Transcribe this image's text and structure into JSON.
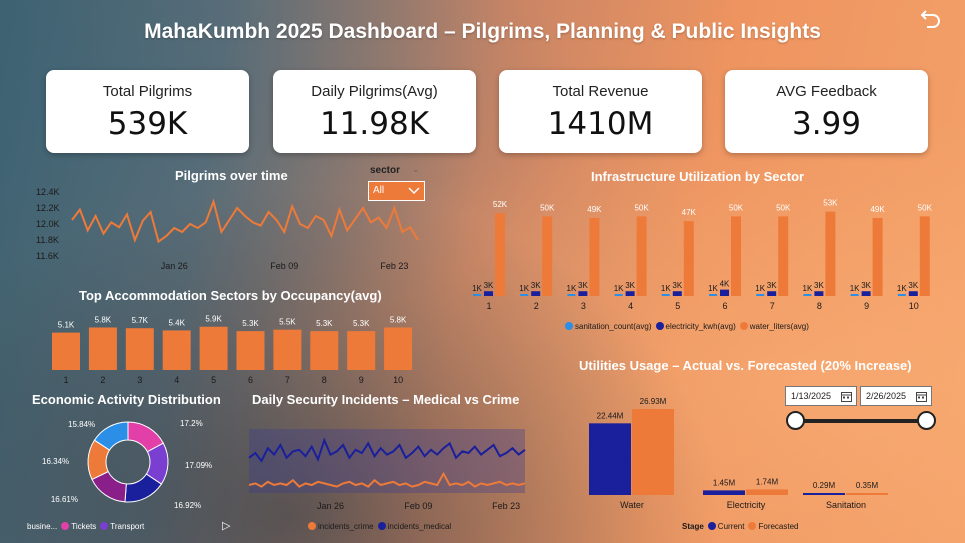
{
  "title": "MahaKumbh 2025 Dashboard – Pilgrims, Planning & Public Insights",
  "kpis": [
    {
      "label": "Total Pilgrims",
      "value": "539K"
    },
    {
      "label": "Daily Pilgrims(Avg)",
      "value": "11.98K"
    },
    {
      "label": "Total Revenue",
      "value": "1410M"
    },
    {
      "label": "AVG Feedback",
      "value": "3.99"
    }
  ],
  "slicer": {
    "label": "sector",
    "value": "All"
  },
  "icons": {
    "back": "back-arrow-icon",
    "dropdown": "chevron-down-icon",
    "calendar": "calendar-icon",
    "play": "play-icon"
  },
  "colors": {
    "orange": "#ee7a3a",
    "navy": "#1a1f9c",
    "blue": "#2b8fe8",
    "text_light": "#ffffff",
    "text_dark": "#1a1a1a"
  },
  "chart_data": [
    {
      "id": "pilgrims_over_time",
      "type": "line",
      "title": "Pilgrims over time",
      "x_ticks": [
        "Jan 26",
        "Feb 09",
        "Feb 23"
      ],
      "y_ticks": [
        "12.4K",
        "12.2K",
        "12.0K",
        "11.8K",
        "11.6K"
      ],
      "ylim": [
        11.6,
        12.4
      ],
      "x": [
        "2025-01-13",
        "2025-01-14",
        "2025-01-15",
        "2025-01-16",
        "2025-01-17",
        "2025-01-18",
        "2025-01-19",
        "2025-01-20",
        "2025-01-21",
        "2025-01-22",
        "2025-01-23",
        "2025-01-24",
        "2025-01-25",
        "2025-01-26",
        "2025-01-27",
        "2025-01-28",
        "2025-01-29",
        "2025-01-30",
        "2025-01-31",
        "2025-02-01",
        "2025-02-02",
        "2025-02-03",
        "2025-02-04",
        "2025-02-05",
        "2025-02-06",
        "2025-02-07",
        "2025-02-08",
        "2025-02-09",
        "2025-02-10",
        "2025-02-11",
        "2025-02-12",
        "2025-02-13",
        "2025-02-14",
        "2025-02-15",
        "2025-02-16",
        "2025-02-17",
        "2025-02-18",
        "2025-02-19",
        "2025-02-20",
        "2025-02-21",
        "2025-02-22",
        "2025-02-23",
        "2025-02-24",
        "2025-02-25",
        "2025-02-26"
      ],
      "values": [
        12.05,
        12.18,
        11.92,
        12.1,
        11.88,
        12.02,
        11.96,
        12.12,
        11.8,
        12.04,
        12.15,
        11.78,
        11.85,
        11.95,
        11.9,
        12.0,
        11.95,
        12.02,
        12.28,
        11.9,
        12.05,
        12.2,
        12.1,
        12.02,
        11.98,
        12.15,
        12.05,
        11.9,
        12.22,
        12.0,
        11.95,
        12.1,
        12.05,
        11.85,
        12.18,
        11.92,
        12.06,
        12.2,
        12.02,
        12.08,
        11.95,
        12.2,
        11.9,
        11.96,
        11.8
      ]
    },
    {
      "id": "accommodation_occupancy",
      "type": "bar",
      "title": "Top Accommodation Sectors by Occupancy(avg)",
      "categories": [
        "1",
        "2",
        "3",
        "4",
        "5",
        "6",
        "7",
        "8",
        "9",
        "10"
      ],
      "values": [
        5.1,
        5.8,
        5.7,
        5.4,
        5.9,
        5.3,
        5.5,
        5.3,
        5.3,
        5.8
      ],
      "labels": [
        "5.1K",
        "5.8K",
        "5.7K",
        "5.4K",
        "5.9K",
        "5.3K",
        "5.5K",
        "5.3K",
        "5.3K",
        "5.8K"
      ]
    },
    {
      "id": "infrastructure_utilization",
      "type": "bar",
      "title": "Infrastructure Utilization by Sector",
      "categories": [
        "1",
        "2",
        "3",
        "4",
        "5",
        "6",
        "7",
        "8",
        "9",
        "10"
      ],
      "series": [
        {
          "name": "sanitation_count(avg)",
          "color": "#2b8fe8",
          "values": [
            1,
            1,
            1,
            1,
            1,
            1,
            1,
            1,
            1,
            1
          ],
          "labels": [
            "1K",
            "1K",
            "1K",
            "1K",
            "1K",
            "1K",
            "1K",
            "1K",
            "1K",
            "1K"
          ]
        },
        {
          "name": "electricity_kwh(avg)",
          "color": "#1a1f9c",
          "values": [
            3,
            3,
            3,
            3,
            3,
            4,
            3,
            3,
            3,
            3
          ],
          "labels": [
            "3K",
            "3K",
            "3K",
            "3K",
            "3K",
            "4K",
            "3K",
            "3K",
            "3K",
            "3K"
          ]
        },
        {
          "name": "water_liters(avg)",
          "color": "#ee7a3a",
          "values": [
            52,
            50,
            49,
            50,
            47,
            50,
            50,
            53,
            49,
            50
          ],
          "labels": [
            "52K",
            "50K",
            "49K",
            "50K",
            "47K",
            "50K",
            "50K",
            "53K",
            "49K",
            "50K"
          ]
        }
      ]
    },
    {
      "id": "economic_activity",
      "type": "pie",
      "title": "Economic Activity Distribution",
      "slices": [
        {
          "name": "Tickets",
          "value": 17.2,
          "label": "17.2%",
          "color": "#e23fa8"
        },
        {
          "name": "Transport",
          "value": 17.09,
          "label": "17.09%",
          "color": "#7a3fd0"
        },
        {
          "name": "",
          "value": 16.92,
          "label": "16.92%",
          "color": "#1a1f9c"
        },
        {
          "name": "",
          "value": 16.61,
          "label": "16.61%",
          "color": "#8a1f8a"
        },
        {
          "name": "",
          "value": 16.34,
          "label": "16.34%",
          "color": "#ee7a3a"
        },
        {
          "name": "",
          "value": 15.84,
          "label": "15.84%",
          "color": "#2b8fe8"
        }
      ],
      "legend_title": "busine..."
    },
    {
      "id": "security_incidents",
      "type": "line",
      "title": "Daily Security Incidents – Medical vs Crime",
      "x_ticks": [
        "Jan 26",
        "Feb 09",
        "Feb 23"
      ],
      "ylim": [
        0,
        40
      ],
      "series": [
        {
          "name": "incidents_crime",
          "color": "#ee7a3a",
          "values": [
            5,
            6,
            4,
            7,
            5,
            6,
            5,
            8,
            4,
            6,
            5,
            7,
            6,
            5,
            4,
            6,
            7,
            5,
            6,
            4,
            8,
            5,
            6,
            7,
            5,
            6,
            4,
            5,
            7,
            6,
            5,
            12,
            5,
            6,
            5,
            7,
            4,
            6,
            5,
            6,
            7,
            5,
            6,
            5,
            6
          ]
        },
        {
          "name": "incidents_medical",
          "color": "#1a1f9c",
          "values": [
            22,
            25,
            20,
            28,
            24,
            30,
            22,
            26,
            27,
            23,
            29,
            21,
            33,
            24,
            26,
            30,
            22,
            27,
            25,
            31,
            23,
            28,
            24,
            26,
            30,
            22,
            25,
            29,
            23,
            27,
            24,
            28,
            31,
            22,
            26,
            25,
            29,
            24,
            27,
            30,
            23,
            25,
            28,
            24,
            27
          ]
        }
      ]
    },
    {
      "id": "utilities_usage",
      "type": "bar",
      "title": "Utilities Usage – Actual vs. Forecasted (20% Increase)",
      "categories": [
        "Water",
        "Electricity",
        "Sanitation"
      ],
      "series": [
        {
          "name": "Current",
          "color": "#1a1f9c",
          "values": [
            22.44,
            1.45,
            0.29
          ],
          "labels": [
            "22.44M",
            "1.45M",
            "0.29M"
          ]
        },
        {
          "name": "Forecasted",
          "color": "#ee7a3a",
          "values": [
            26.93,
            1.74,
            0.35
          ],
          "labels": [
            "26.93M",
            "1.74M",
            "0.35M"
          ]
        }
      ],
      "legend_title": "Stage"
    }
  ],
  "date_range": {
    "start": "1/13/2025",
    "end": "2/26/2025"
  }
}
